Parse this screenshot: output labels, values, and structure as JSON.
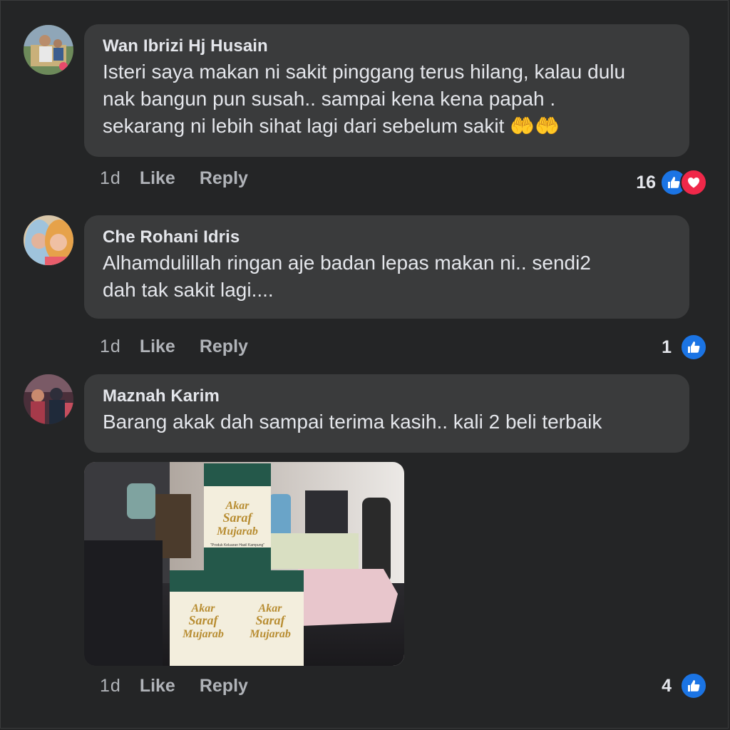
{
  "comments": [
    {
      "author": "Wan Ibrizi Hj Husain",
      "lines": [
        "Isteri saya makan ni sakit pinggang terus hilang, kalau dulu",
        "nak bangun pun susah.. sampai kena kena papah .",
        "sekarang ni lebih sihat lagi dari sebelum sakit"
      ],
      "emoji": "🤲🤲",
      "time": "1d",
      "like_label": "Like",
      "reply_label": "Reply",
      "reaction_count": "16",
      "reactions": [
        "like-icon",
        "love-icon"
      ]
    },
    {
      "author": "Che Rohani Idris",
      "lines": [
        "Alhamdulillah ringan aje badan lepas makan ni.. sendi2",
        "dah tak sakit lagi...."
      ],
      "time": "1d",
      "like_label": "Like",
      "reply_label": "Reply",
      "reaction_count": "1",
      "reactions": [
        "like-icon"
      ]
    },
    {
      "author": "Maznah Karim",
      "lines": [
        "Barang akak dah sampai terima kasih.. kali 2 beli terbaik"
      ],
      "time": "1d",
      "like_label": "Like",
      "reply_label": "Reply",
      "reaction_count": "4",
      "reactions": [
        "like-icon"
      ],
      "photo": {
        "product_brand_lines": [
          "Akar",
          "Saraf",
          "Mujarab"
        ],
        "product_tagline": "\"Produk Keluaran Hasil Kampung\""
      }
    }
  ],
  "colors": {
    "background": "#242526",
    "bubble": "#3a3b3c",
    "text_primary": "#e4e6eb",
    "text_secondary": "#b0b3b8",
    "like_blue": "#1b74e4",
    "love_red": "#f02849"
  }
}
